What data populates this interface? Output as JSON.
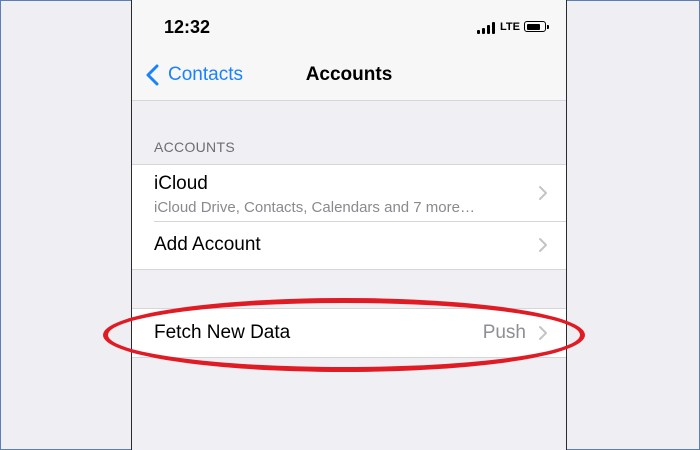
{
  "status_bar": {
    "time": "12:32",
    "network": "LTE",
    "icons": [
      "signal-bars-icon",
      "battery-icon"
    ]
  },
  "nav": {
    "back_label": "Contacts",
    "title": "Accounts"
  },
  "accounts_section": {
    "header": "ACCOUNTS",
    "rows": [
      {
        "title": "iCloud",
        "subtitle": "iCloud Drive, Contacts, Calendars and 7 more…"
      },
      {
        "title": "Add Account"
      }
    ]
  },
  "fetch_section": {
    "rows": [
      {
        "title": "Fetch New Data",
        "value": "Push"
      }
    ]
  },
  "colors": {
    "accent": "#1a82fb",
    "annotation": "#e01b24",
    "background": "#efeff4"
  }
}
